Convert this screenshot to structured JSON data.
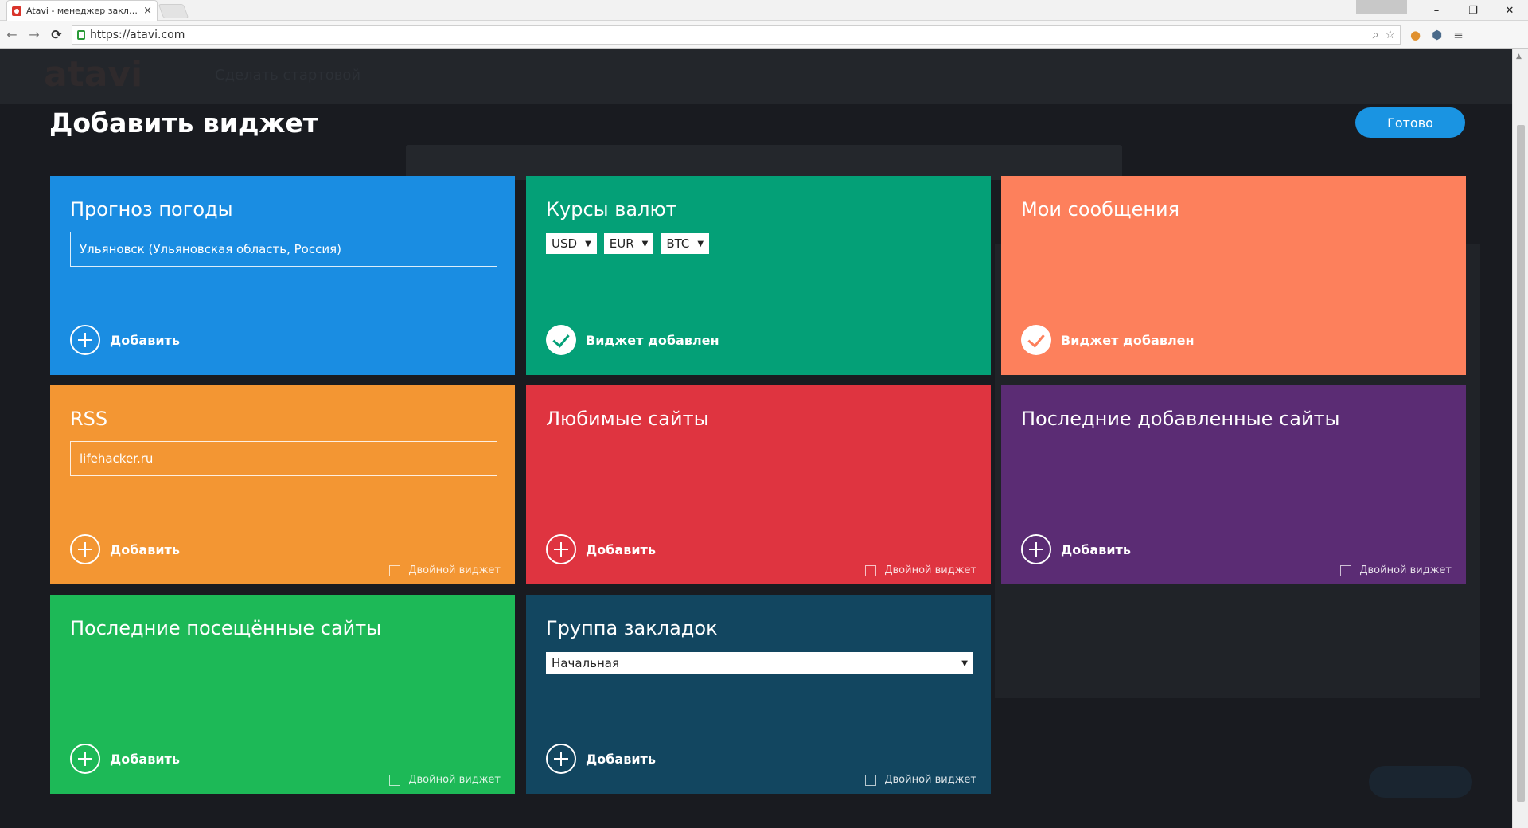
{
  "browser": {
    "tab_title": "Atavi - менеджер заклад",
    "tab_close": "×",
    "url": "https://atavi.com",
    "window_buttons": [
      "–",
      "❐",
      "✕"
    ]
  },
  "background": {
    "logo": "atavi",
    "slogan": "Сделать стартовой"
  },
  "overlay": {
    "title": "Добавить виджет",
    "done_label": "Готово"
  },
  "tiles": {
    "weather": {
      "title": "Прогноз погоды",
      "input_value": "Ульяновск (Ульяновская область, Россия)",
      "action": "Добавить",
      "color": "#1a8de2"
    },
    "currency": {
      "title": "Курсы валют",
      "selects": [
        "USD",
        "EUR",
        "BTC"
      ],
      "status": "Виджет добавлен",
      "color": "#04a077"
    },
    "messages": {
      "title": "Мои сообщения",
      "status": "Виджет добавлен",
      "color": "#fd805c"
    },
    "rss": {
      "title": "RSS",
      "input_value": "lifehacker.ru",
      "action": "Добавить",
      "double": "Двойной виджет",
      "color": "#f39633"
    },
    "favorites": {
      "title": "Любимые сайты",
      "action": "Добавить",
      "double": "Двойной виджет",
      "color": "#df3440"
    },
    "recent_added": {
      "title": "Последние добавленные сайты",
      "action": "Добавить",
      "double": "Двойной виджет",
      "color": "#5b2c74"
    },
    "recent_visited": {
      "title": "Последние посещённые сайты",
      "action": "Добавить",
      "double": "Двойной виджет",
      "color": "#1db957"
    },
    "bookmark_group": {
      "title": "Группа закладок",
      "select_value": "Начальная",
      "action": "Добавить",
      "double": "Двойной виджет",
      "color": "#124660"
    }
  }
}
